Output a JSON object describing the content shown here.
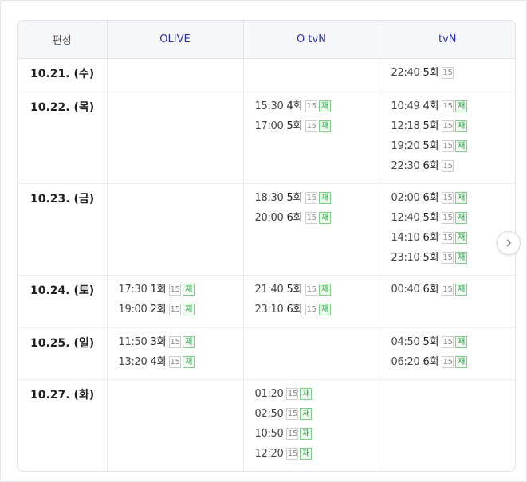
{
  "table": {
    "headers": [
      "편성",
      "OLIVE",
      "O tvN",
      "tvN"
    ],
    "rows": [
      {
        "date": "10.21. (수)",
        "height": 42,
        "olive": [],
        "otvn": [],
        "tvn": [
          {
            "time": "22:40",
            "ep": "5회",
            "rating": "15",
            "rerun": ""
          }
        ]
      },
      {
        "date": "10.22. (목)",
        "height": 115,
        "olive": [],
        "otvn": [
          {
            "time": "15:30",
            "ep": "4회",
            "rating": "15",
            "rerun": "재"
          },
          {
            "time": "17:00",
            "ep": "5회",
            "rating": "15",
            "rerun": "재"
          }
        ],
        "tvn": [
          {
            "time": "10:49",
            "ep": "4회",
            "rating": "15",
            "rerun": "재"
          },
          {
            "time": "12:18",
            "ep": "5회",
            "rating": "15",
            "rerun": "재"
          },
          {
            "time": "19:20",
            "ep": "5회",
            "rating": "15",
            "rerun": "재"
          },
          {
            "time": "22:30",
            "ep": "6회",
            "rating": "15",
            "rerun": ""
          }
        ]
      },
      {
        "date": "10.23. (금)",
        "height": 115,
        "olive": [],
        "otvn": [
          {
            "time": "18:30",
            "ep": "5회",
            "rating": "15",
            "rerun": "재"
          },
          {
            "time": "20:00",
            "ep": "6회",
            "rating": "15",
            "rerun": "재"
          }
        ],
        "tvn": [
          {
            "time": "02:00",
            "ep": "6회",
            "rating": "15",
            "rerun": "재"
          },
          {
            "time": "12:40",
            "ep": "5회",
            "rating": "15",
            "rerun": "재"
          },
          {
            "time": "14:10",
            "ep": "6회",
            "rating": "15",
            "rerun": "재"
          },
          {
            "time": "23:10",
            "ep": "5회",
            "rating": "15",
            "rerun": "재"
          }
        ]
      },
      {
        "date": "10.24. (토)",
        "height": 66,
        "olive": [
          {
            "time": "17:30",
            "ep": "1회",
            "rating": "15",
            "rerun": "재"
          },
          {
            "time": "19:00",
            "ep": "2회",
            "rating": "15",
            "rerun": "재"
          }
        ],
        "otvn": [
          {
            "time": "21:40",
            "ep": "5회",
            "rating": "15",
            "rerun": "재"
          },
          {
            "time": "23:10",
            "ep": "6회",
            "rating": "15",
            "rerun": "재"
          }
        ],
        "tvn": [
          {
            "time": "00:40",
            "ep": "6회",
            "rating": "15",
            "rerun": "재"
          }
        ]
      },
      {
        "date": "10.25. (일)",
        "height": 65,
        "olive": [
          {
            "time": "11:50",
            "ep": "3회",
            "rating": "15",
            "rerun": "재"
          },
          {
            "time": "13:20",
            "ep": "4회",
            "rating": "15",
            "rerun": "재"
          }
        ],
        "otvn": [],
        "tvn": [
          {
            "time": "04:50",
            "ep": "5회",
            "rating": "15",
            "rerun": "재"
          },
          {
            "time": "06:20",
            "ep": "6회",
            "rating": "15",
            "rerun": "재"
          }
        ]
      },
      {
        "date": "10.27. (화)",
        "height": 116,
        "olive": [],
        "otvn": [
          {
            "time": "01:20",
            "ep": "",
            "rating": "15",
            "rerun": "재"
          },
          {
            "time": "02:50",
            "ep": "",
            "rating": "15",
            "rerun": "재"
          },
          {
            "time": "10:50",
            "ep": "",
            "rating": "15",
            "rerun": "재"
          },
          {
            "time": "12:20",
            "ep": "",
            "rating": "15",
            "rerun": "재"
          }
        ],
        "tvn": []
      }
    ]
  },
  "next_icon": "chevron-right-icon"
}
